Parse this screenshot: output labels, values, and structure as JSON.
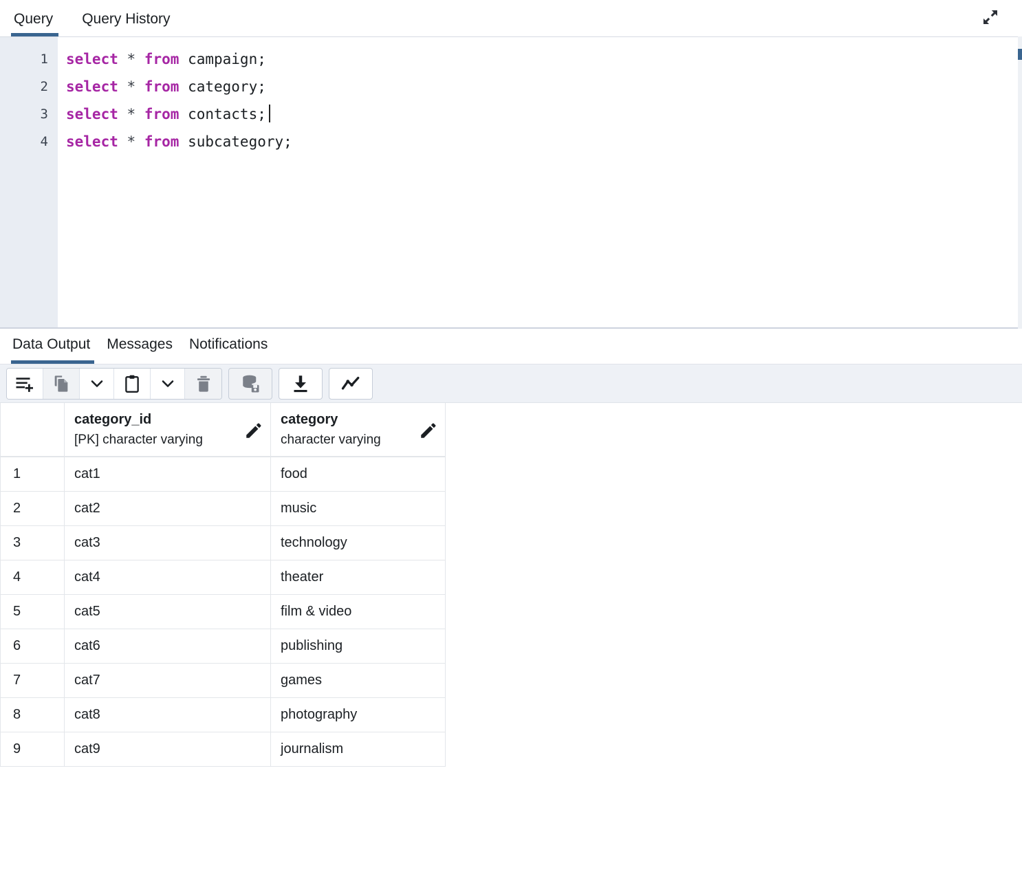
{
  "query_panel": {
    "tabs": [
      {
        "label": "Query",
        "active": true
      },
      {
        "label": "Query History",
        "active": false
      }
    ],
    "expand_icon": "expand-diagonal-icon",
    "editor": {
      "line_numbers": [
        "1",
        "2",
        "3",
        "4"
      ],
      "lines": [
        {
          "keyword1": "select",
          "star": "*",
          "keyword2": "from",
          "table": "campaign;",
          "cursor": false
        },
        {
          "keyword1": "select",
          "star": "*",
          "keyword2": "from",
          "table": "category;",
          "cursor": false
        },
        {
          "keyword1": "select",
          "star": "*",
          "keyword2": "from",
          "table": "contacts;",
          "cursor": true
        },
        {
          "keyword1": "select",
          "star": "*",
          "keyword2": "from",
          "table": "subcategory;",
          "cursor": false
        }
      ]
    }
  },
  "output_panel": {
    "tabs": [
      {
        "label": "Data Output",
        "active": true
      },
      {
        "label": "Messages",
        "active": false
      },
      {
        "label": "Notifications",
        "active": false
      }
    ],
    "toolbar": [
      {
        "name": "add-row-icon",
        "enabled": true
      },
      {
        "name": "copy-icon",
        "enabled": false
      },
      {
        "name": "chevron-down-icon",
        "enabled": true
      },
      {
        "name": "paste-icon",
        "enabled": true
      },
      {
        "name": "chevron-down-icon",
        "enabled": true
      },
      {
        "name": "delete-row-icon",
        "enabled": false
      },
      {
        "name": "save-data-changes-icon",
        "enabled": false
      },
      {
        "name": "download-csv-icon",
        "enabled": true
      },
      {
        "name": "graph-visualiser-icon",
        "enabled": true
      }
    ],
    "grid": {
      "columns": [
        {
          "name": "category_id",
          "type": "[PK] character varying",
          "edit_icon": "pencil-icon"
        },
        {
          "name": "category",
          "type": "character varying",
          "edit_icon": "pencil-icon"
        }
      ],
      "rows": [
        {
          "n": "1",
          "category_id": "cat1",
          "category": "food"
        },
        {
          "n": "2",
          "category_id": "cat2",
          "category": "music"
        },
        {
          "n": "3",
          "category_id": "cat3",
          "category": "technology"
        },
        {
          "n": "4",
          "category_id": "cat4",
          "category": "theater"
        },
        {
          "n": "5",
          "category_id": "cat5",
          "category": "film & video"
        },
        {
          "n": "6",
          "category_id": "cat6",
          "category": "publishing"
        },
        {
          "n": "7",
          "category_id": "cat7",
          "category": "games"
        },
        {
          "n": "8",
          "category_id": "cat8",
          "category": "photography"
        },
        {
          "n": "9",
          "category_id": "cat9",
          "category": "journalism"
        }
      ]
    }
  },
  "colors": {
    "accent_blue": "#3a6590",
    "keyword_purple": "#a626a4",
    "gutter_bg": "#e9edf3",
    "toolbar_bg": "#eef1f6",
    "grid_border": "#e3e6ea"
  }
}
